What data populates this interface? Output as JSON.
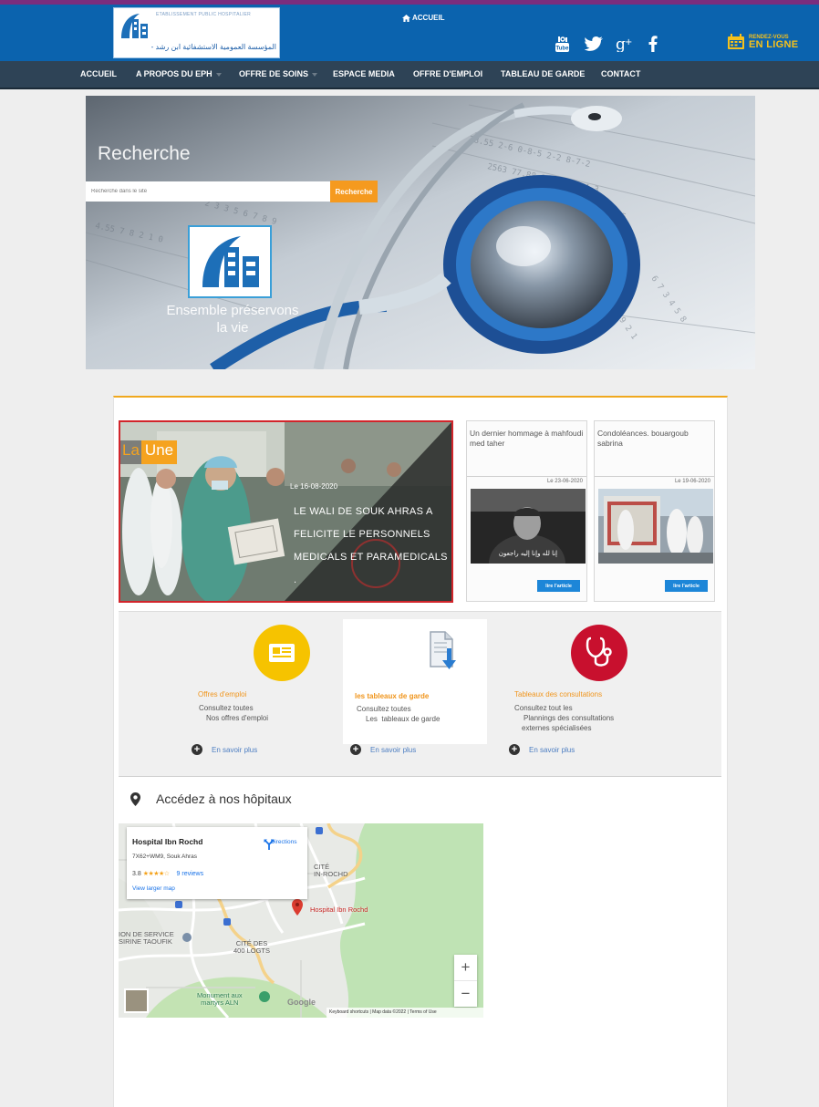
{
  "header": {
    "logo_fr": "ETABLISSEMENT PUBLIC HOSPITALIER",
    "logo_ar": "المؤسسة العمومية الاستشفائية ابن رشد - سوق أهراس",
    "home_label": "ACCUEIL",
    "social_icons": [
      "youtube-icon",
      "twitter-icon",
      "googleplus-icon",
      "facebook-icon"
    ],
    "rdv_line1": "RENDEZ-VOUS",
    "rdv_line2": "EN LIGNE",
    "colors": {
      "bar": "#0b63ae",
      "accent": "#f6c11b",
      "stripe": "#7b2d7e"
    }
  },
  "nav": {
    "items": [
      {
        "label": "ACCUEIL",
        "dropdown": false
      },
      {
        "label": "A PROPOS DU EPH",
        "dropdown": true
      },
      {
        "label": "OFFRE DE SOINS",
        "dropdown": true
      },
      {
        "label": "ESPACE MEDIA",
        "dropdown": false
      },
      {
        "label": "OFFRE D'EMPLOI",
        "dropdown": false
      },
      {
        "label": "TABLEAU DE GARDE",
        "dropdown": false
      },
      {
        "label": "CONTACT",
        "dropdown": false
      }
    ]
  },
  "hero": {
    "search_title": "Recherche",
    "search_placeholder": "Recherche dans le site",
    "search_button": "Recherche",
    "slogan_line1": "Ensemble préservons",
    "slogan_line2": "la vie"
  },
  "une": {
    "badge_la": "La",
    "badge_une": "Une",
    "date": "Le 16-08-2020",
    "title": "LE WALI DE SOUK AHRAS A FELICITE LE PERSONNELS MEDICALS ET PARAMEDICALS ."
  },
  "cards": [
    {
      "title": "Un dernier hommage à mahfoudi med taher",
      "date": "Le 23-06-2020",
      "button": "lire l'article"
    },
    {
      "title": "Condoléances. bouargoub sabrina",
      "date": "Le 19-06-2020",
      "button": "lire l'article"
    }
  ],
  "features": [
    {
      "title": "Offres d'emploi",
      "desc_line1": "Consultez toutes",
      "desc_line2": "Nos offres d'emploi",
      "desc_line3": "",
      "more": "En savoir plus"
    },
    {
      "title": "les tableaux de garde",
      "desc_line1": "Consultez toutes",
      "desc_line2": "Les  tableaux de garde",
      "desc_line3": "",
      "more": "En savoir plus"
    },
    {
      "title": "Tableaux des consultations",
      "desc_line1": "Consultez tout les",
      "desc_line2": "Plannings des consultations",
      "desc_line3": "externes spécialisées",
      "more": "En savoir plus"
    }
  ],
  "map_section": {
    "title": "Accédez à nos hôpitaux",
    "card": {
      "name": "Hospital Ibn Rochd",
      "address": "7X62+WM9, Souk Ahras",
      "rating": "3.8",
      "stars": "★★★★☆",
      "reviews": "9 reviews",
      "larger": "View larger map",
      "directions": "Directions"
    },
    "labels": {
      "cite_ibn_rochd_1": "CITÉ",
      "cite_ibn_rochd_2": "IN-ROCHD",
      "hospital": "Hospital Ibn Rochd",
      "service_1": "ION DE SERVICE",
      "service_2": "SIRINE TAOUFIK",
      "logts_1": "CITÉ DES",
      "logts_2": "400 LOGTS",
      "monument_1": "Monument aux",
      "monument_2": "martyrs ALN"
    },
    "zoom_in": "+",
    "zoom_out": "−",
    "google": "Google",
    "footer": "Keyboard shortcuts  |  Map data ©2022  |  Terms of Use"
  }
}
